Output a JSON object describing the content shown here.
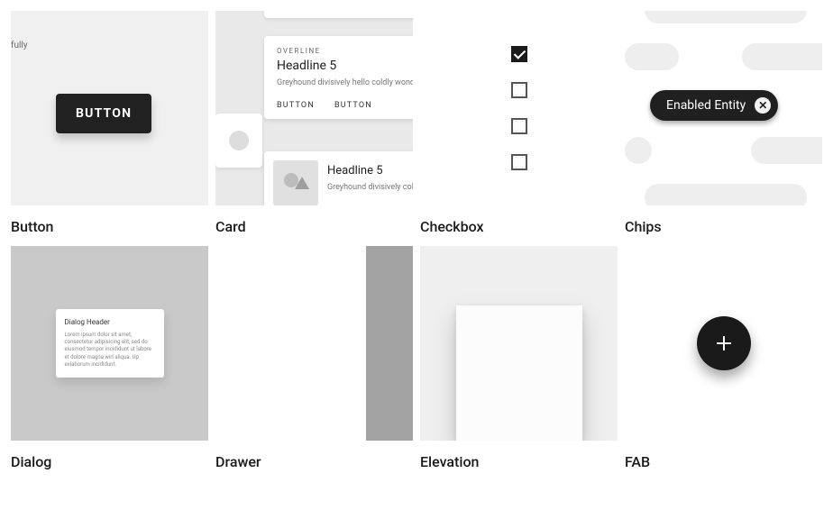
{
  "tiles": {
    "button": {
      "label": "Button",
      "btn_text": "BUTTON",
      "cut_text": "fully"
    },
    "card": {
      "label": "Card",
      "overline": "OVERLINE",
      "headline_a": "Headline 5",
      "body_a": "Greyhound divisively hello coldly wonderfully...",
      "action1": "BUTTON",
      "action2": "BUTTON",
      "headline_b": "Headline 5",
      "body_b": "Greyhound divisively coldly..."
    },
    "checkbox": {
      "label": "Checkbox"
    },
    "chips": {
      "label": "Chips",
      "chip_text": "Enabled Entity",
      "close_glyph": "✕"
    },
    "dialog": {
      "label": "Dialog",
      "header": "Dialog Header",
      "body": "Lorem ipsum dolor sit amet, consectetur adipisicing elit, sed do eiusmod tempor incididunt ut labore et dolore magna wirl aliqua. Up exlaborum incididunt."
    },
    "drawer": {
      "label": "Drawer"
    },
    "elevation": {
      "label": "Elevation"
    },
    "fab": {
      "label": "FAB"
    }
  },
  "colors": {
    "dark": "#1a1a1a",
    "bg": "#f0f0f0",
    "chip": "#202020"
  }
}
